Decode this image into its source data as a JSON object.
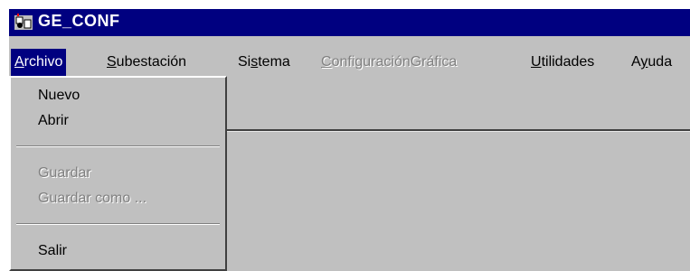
{
  "window": {
    "title": "GE_CONF",
    "icon": "app-icon"
  },
  "menubar": {
    "items": [
      {
        "label": "Archivo",
        "mnemonic": "A",
        "rest": "rchivo",
        "state": "open"
      },
      {
        "label": "Subestación",
        "mnemonic": "S",
        "rest": "ubestación",
        "state": "enabled"
      },
      {
        "label": "Sistema",
        "pre": "Si",
        "mnemonic": "s",
        "rest": "tema",
        "state": "enabled"
      },
      {
        "label": "ConfiguraciónGráfica",
        "mnemonic": "C",
        "rest": "onfiguraciónGráfica",
        "state": "disabled"
      },
      {
        "label": "Utilidades",
        "mnemonic": "U",
        "rest": "tilidades",
        "state": "enabled"
      },
      {
        "label": "Ayuda",
        "pre": "A",
        "mnemonic": "y",
        "rest": "uda",
        "state": "enabled"
      }
    ]
  },
  "archivo_menu": {
    "items": [
      {
        "label": "Nuevo",
        "state": "enabled"
      },
      {
        "label": "Abrir",
        "state": "enabled"
      },
      {
        "label": "Guardar",
        "state": "disabled"
      },
      {
        "label": "Guardar como ...",
        "state": "disabled"
      },
      {
        "label": "Salir",
        "state": "enabled"
      }
    ]
  },
  "colors": {
    "titlebar": "#000080",
    "face": "#c0c0c0",
    "disabled_text": "#808080",
    "highlight": "#ffffff",
    "shadow": "#404040"
  }
}
